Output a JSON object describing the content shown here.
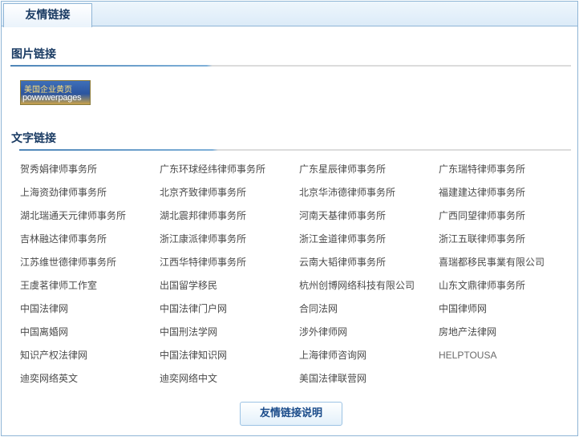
{
  "tab": {
    "label": "友情链接"
  },
  "image_section": {
    "title": "图片链接",
    "logo": {
      "line1": "美国企业黄页",
      "line2": "powwwerpages"
    }
  },
  "text_section": {
    "title": "文字链接",
    "links": [
      "贺秀娟律师事务所",
      "广东环球经纬律师事务所",
      "广东星辰律师事务所",
      "广东瑞特律师事务所",
      "上海资劲律师事务所",
      "北京齐致律师事务所",
      "北京华沛德律师事务所",
      "福建建达律师事务所",
      "湖北瑞通天元律师事务所",
      "湖北震邦律师事务所",
      "河南天基律师事务所",
      "广西同望律师事务所",
      "吉林融达律师事务所",
      "浙江康派律师事务所",
      "浙江金道律师事务所",
      "浙江五联律师事务所",
      "江苏维世德律师事务所",
      "江西华特律师事务所",
      "云南大韬律师事务所",
      "喜瑞都移民事業有限公司",
      "王虞茗律师工作室",
      "出国留学移民",
      "杭州创博网络科技有限公司",
      "山东文鼎律师事务所",
      "中国法律网",
      "中国法律门户网",
      "合同法网",
      "中国律师网",
      "中国离婚网",
      "中国刑法学网",
      "涉外律师网",
      "房地产法律网",
      "知识产权法律网",
      "中国法律知识网",
      "上海律师咨询网",
      "HELPTOUSA",
      "迪奕网络英文",
      "迪奕网络中文",
      "美国法律联营网"
    ]
  },
  "footer": {
    "button_label": "友情链接说明"
  }
}
